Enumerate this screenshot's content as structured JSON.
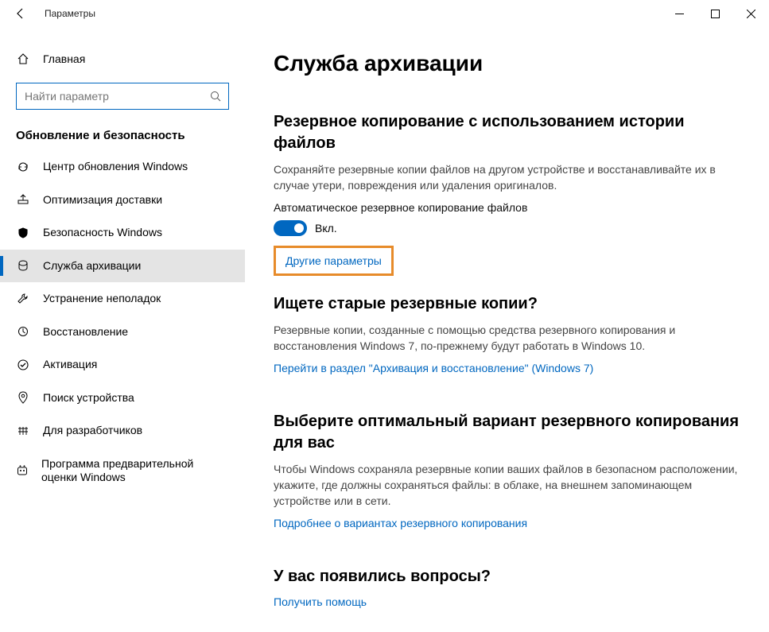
{
  "titlebar": {
    "title": "Параметры"
  },
  "sidebar": {
    "home": "Главная",
    "search_placeholder": "Найти параметр",
    "group": "Обновление и безопасность",
    "items": [
      {
        "label": "Центр обновления Windows"
      },
      {
        "label": "Оптимизация доставки"
      },
      {
        "label": "Безопасность Windows"
      },
      {
        "label": "Служба архивации"
      },
      {
        "label": "Устранение неполадок"
      },
      {
        "label": "Восстановление"
      },
      {
        "label": "Активация"
      },
      {
        "label": "Поиск устройства"
      },
      {
        "label": "Для разработчиков"
      },
      {
        "label": "Программа предварительной оценки Windows"
      }
    ]
  },
  "main": {
    "title": "Служба архивации",
    "sec1": {
      "heading": "Резервное копирование с использованием истории файлов",
      "desc": "Сохраняйте резервные копии файлов на другом устройстве и восстанавливайте их в случае утери, повреждения или удаления оригиналов.",
      "toggle_label": "Автоматическое резервное копирование файлов",
      "toggle_state": "Вкл.",
      "more_link": "Другие параметры"
    },
    "sec2": {
      "heading": "Ищете старые резервные копии?",
      "desc": "Резервные копии, созданные с помощью средства резервного копирования и восстановления Windows 7, по-прежнему будут работать в Windows 10.",
      "link": "Перейти в раздел \"Архивация и восстановление\" (Windows 7)"
    },
    "sec3": {
      "heading": "Выберите оптимальный вариант резервного копирования для вас",
      "desc": "Чтобы Windows сохраняла резервные копии ваших файлов в безопасном расположении, укажите, где должны сохраняться файлы: в облаке, на внешнем запоминающем устройстве или в сети.",
      "link": "Подробнее о вариантах резервного копирования"
    },
    "sec4": {
      "heading": "У вас появились вопросы?",
      "link": "Получить помощь"
    }
  }
}
